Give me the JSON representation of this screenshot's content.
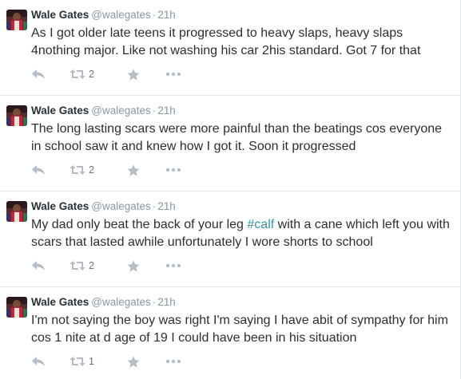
{
  "tweets": [
    {
      "fullname": "Wale Gates",
      "username": "@walegates",
      "dot": "·",
      "time": "21h",
      "text": "As I got older late teens it progressed to heavy slaps, heavy slaps 4nothing major. Like not washing his car 2his standard. Got 7 for that",
      "retweet_count": "2"
    },
    {
      "fullname": "Wale Gates",
      "username": "@walegates",
      "dot": "·",
      "time": "21h",
      "text": "The long lasting scars were more painful than the beatings cos everyone in school saw it and knew how I got it. Soon it progressed",
      "retweet_count": "2"
    },
    {
      "fullname": "Wale Gates",
      "username": "@walegates",
      "dot": "·",
      "time": "21h",
      "text_before": "My dad only beat the back of your leg ",
      "hashtag": "#calf",
      "text_after": " with a cane which left you with scars that lasted awhile unfortunately I wore shorts to school",
      "retweet_count": "2"
    },
    {
      "fullname": "Wale Gates",
      "username": "@walegates",
      "dot": "·",
      "time": "21h",
      "text": "I'm not saying the boy was right I'm saying I have abit of sympathy for him cos 1 nite at d age of 19 I could have been in his situation",
      "retweet_count": "1"
    }
  ],
  "icons": {
    "reply": "reply-icon",
    "retweet": "retweet-icon",
    "favorite": "star-icon",
    "more": "more-dots-icon"
  },
  "colors": {
    "name": "#292f33",
    "meta": "#8899a6",
    "icon": "#b3bcc4",
    "hashtag": "#3a94a8",
    "divider": "#e1e8ed"
  }
}
